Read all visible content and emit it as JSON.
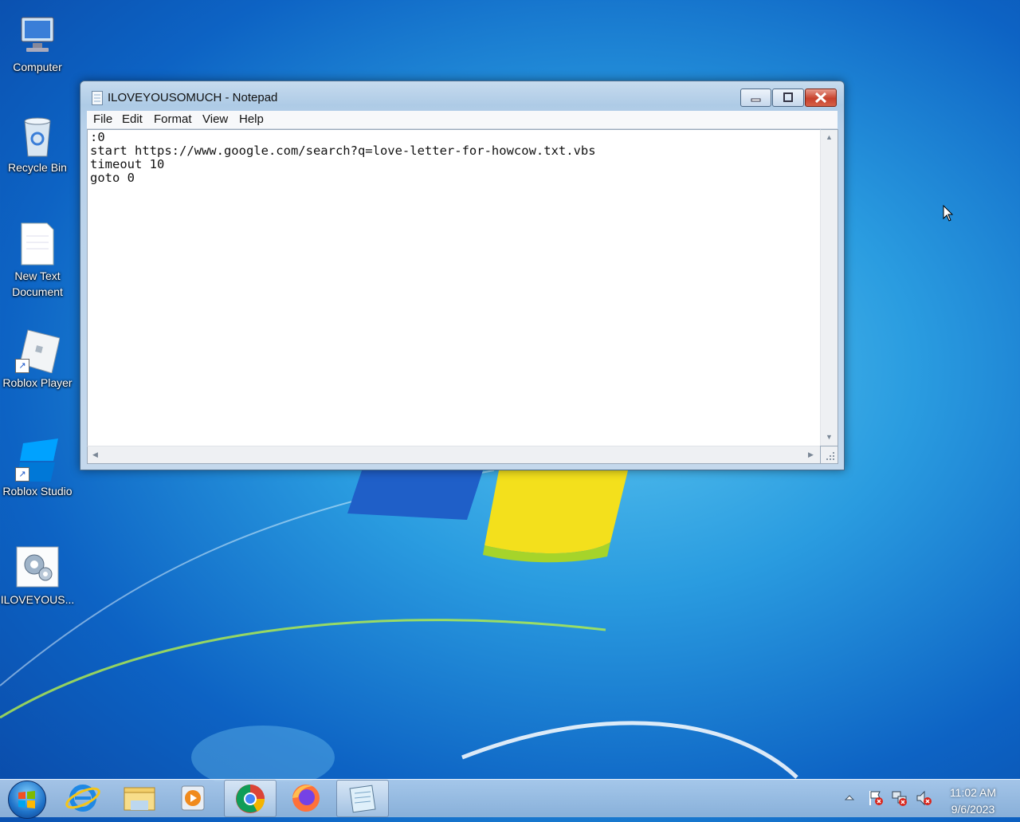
{
  "desktop": {
    "icons": [
      {
        "label": "Computer"
      },
      {
        "label": "Recycle Bin"
      },
      {
        "label": "New Text Document"
      },
      {
        "label": "Roblox Player"
      },
      {
        "label": "Roblox Studio"
      },
      {
        "label": "ILOVEYOUS..."
      }
    ]
  },
  "notepad": {
    "title": "ILOVEYOUSOMUCH - Notepad",
    "menu": [
      "File",
      "Edit",
      "Format",
      "View",
      "Help"
    ],
    "content": ":0\nstart https://www.google.com/search?q=love-letter-for-howcow.txt.vbs\ntimeout 10\ngoto 0"
  },
  "taskbar": {
    "pinned": [
      {
        "icon": "internet-explorer-icon"
      },
      {
        "icon": "file-explorer-icon"
      },
      {
        "icon": "media-player-icon"
      },
      {
        "icon": "chrome-icon"
      },
      {
        "icon": "firefox-icon"
      },
      {
        "icon": "notepad-icon"
      }
    ],
    "active_app": "notepad-icon"
  },
  "tray": {
    "time": "11:02 AM",
    "date": "9/6/2023"
  },
  "colors": {
    "accent": "#2a9ce0",
    "close_button": "#c7412c"
  }
}
